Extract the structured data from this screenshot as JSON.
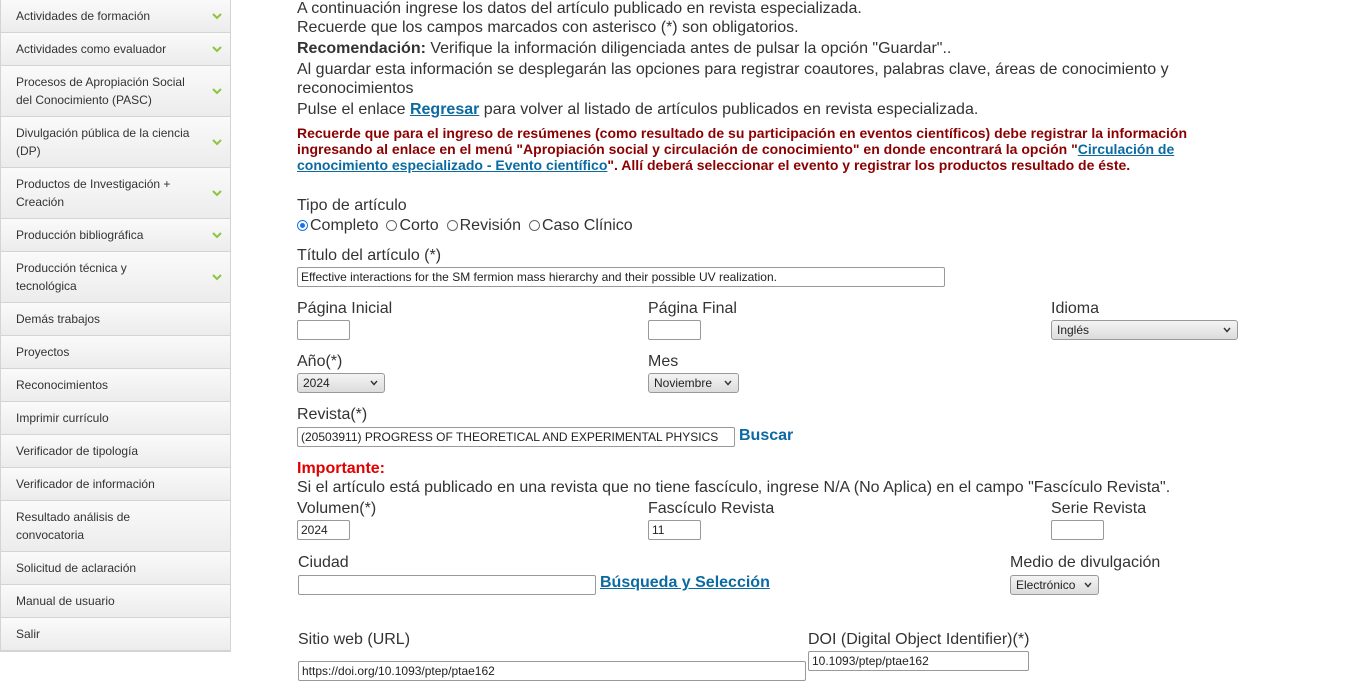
{
  "sidebar": {
    "items": [
      {
        "label": "Actividades de formación",
        "chevron": true
      },
      {
        "label": "Actividades como evaluador",
        "chevron": true
      },
      {
        "label": "Procesos de Apropiación Social del Conocimiento (PASC)",
        "chevron": true
      },
      {
        "label": "Divulgación pública de la ciencia (DP)",
        "chevron": true
      },
      {
        "label": "Productos de Investigación + Creación",
        "chevron": true
      },
      {
        "label": "Producción bibliográfica",
        "chevron": true
      },
      {
        "label": "Producción técnica y tecnológica",
        "chevron": true
      },
      {
        "label": "Demás trabajos",
        "chevron": false
      },
      {
        "label": "Proyectos",
        "chevron": false
      },
      {
        "label": "Reconocimientos",
        "chevron": false
      },
      {
        "label": "Imprimir currículo",
        "chevron": false
      },
      {
        "label": "Verificador de tipología",
        "chevron": false
      },
      {
        "label": "Verificador de información",
        "chevron": false
      },
      {
        "label": "Resultado análisis de convocatoria",
        "chevron": false
      },
      {
        "label": "Solicitud de aclaración",
        "chevron": false
      },
      {
        "label": "Manual de usuario",
        "chevron": false
      },
      {
        "label": "Salir",
        "chevron": false
      }
    ]
  },
  "intro": {
    "line1": "A continuación ingrese los datos del artículo publicado en revista especializada.",
    "line2": "Recuerde que los campos marcados con asterisco (*) son obligatorios.",
    "rec_label": "Recomendación:",
    "rec_text": " Verifique la información diligenciada antes de pulsar la opción \"Guardar\"..",
    "line4a": "Al guardar esta información se desplegarán las opciones para registrar coautores, palabras clave, áreas de conocimiento y",
    "line4b": "reconocimientos",
    "line5_pre": "Pulse el enlace ",
    "line5_link": "Regresar",
    "line5_post": " para volver al listado de artículos publicados en revista especializada."
  },
  "warning": {
    "pre": "Recuerde que para el ingreso de resúmenes (como resultado de su participación en eventos científicos) debe registrar la información ingresando al enlace en el menú \"Apropiación social y circulación de conocimiento\" en donde encontrará la opción \"",
    "link": "Circulación de conocimiento especializado - Evento científico",
    "post": "\". Allí deberá seleccionar el evento y registrar los productos resultado de éste."
  },
  "form": {
    "tipo_label": "Tipo de artículo",
    "tipo_options": [
      "Completo",
      "Corto",
      "Revisión",
      "Caso Clínico"
    ],
    "tipo_selected": "Completo",
    "titulo_label": "Título del artículo (*)",
    "titulo_value": "Effective interactions for the SM fermion mass hierarchy and their possible UV realization.",
    "pag_ini_label": "Página Inicial",
    "pag_ini_value": "",
    "pag_fin_label": "Página Final",
    "pag_fin_value": "",
    "idioma_label": "Idioma",
    "idioma_value": "Inglés",
    "anio_label": "Año(*)",
    "anio_value": "2024",
    "mes_label": "Mes",
    "mes_value": "Noviembre",
    "revista_label": "Revista(*)",
    "revista_value": "(20503911) PROGRESS OF THEORETICAL AND EXPERIMENTAL PHYSICS",
    "buscar_label": "Buscar",
    "importante_label": "Importante:",
    "importante_text": "Si el artículo está publicado en una revista que no tiene fascículo, ingrese N/A (No Aplica) en el campo \"Fascículo Revista\".",
    "volumen_label": "Volumen(*)",
    "volumen_value": "2024",
    "fasciculo_label": "Fascículo Revista",
    "fasciculo_value": "11",
    "serie_label": "Serie Revista",
    "serie_value": "",
    "ciudad_label": "Ciudad",
    "ciudad_value": "",
    "busqueda_label": "Búsqueda y Selección",
    "medio_label": "Medio de divulgación",
    "medio_value": "Electrónico",
    "sitio_label": "Sitio web (URL)",
    "sitio_value": "https://doi.org/10.1093/ptep/ptae162",
    "doi_label": "DOI (Digital Object Identifier)(*)",
    "doi_value": "10.1093/ptep/ptae162"
  },
  "colors": {
    "accent_link": "#0a6aa1",
    "chevron": "#8cc63f",
    "warning": "#8b0000",
    "important": "#e00000"
  }
}
